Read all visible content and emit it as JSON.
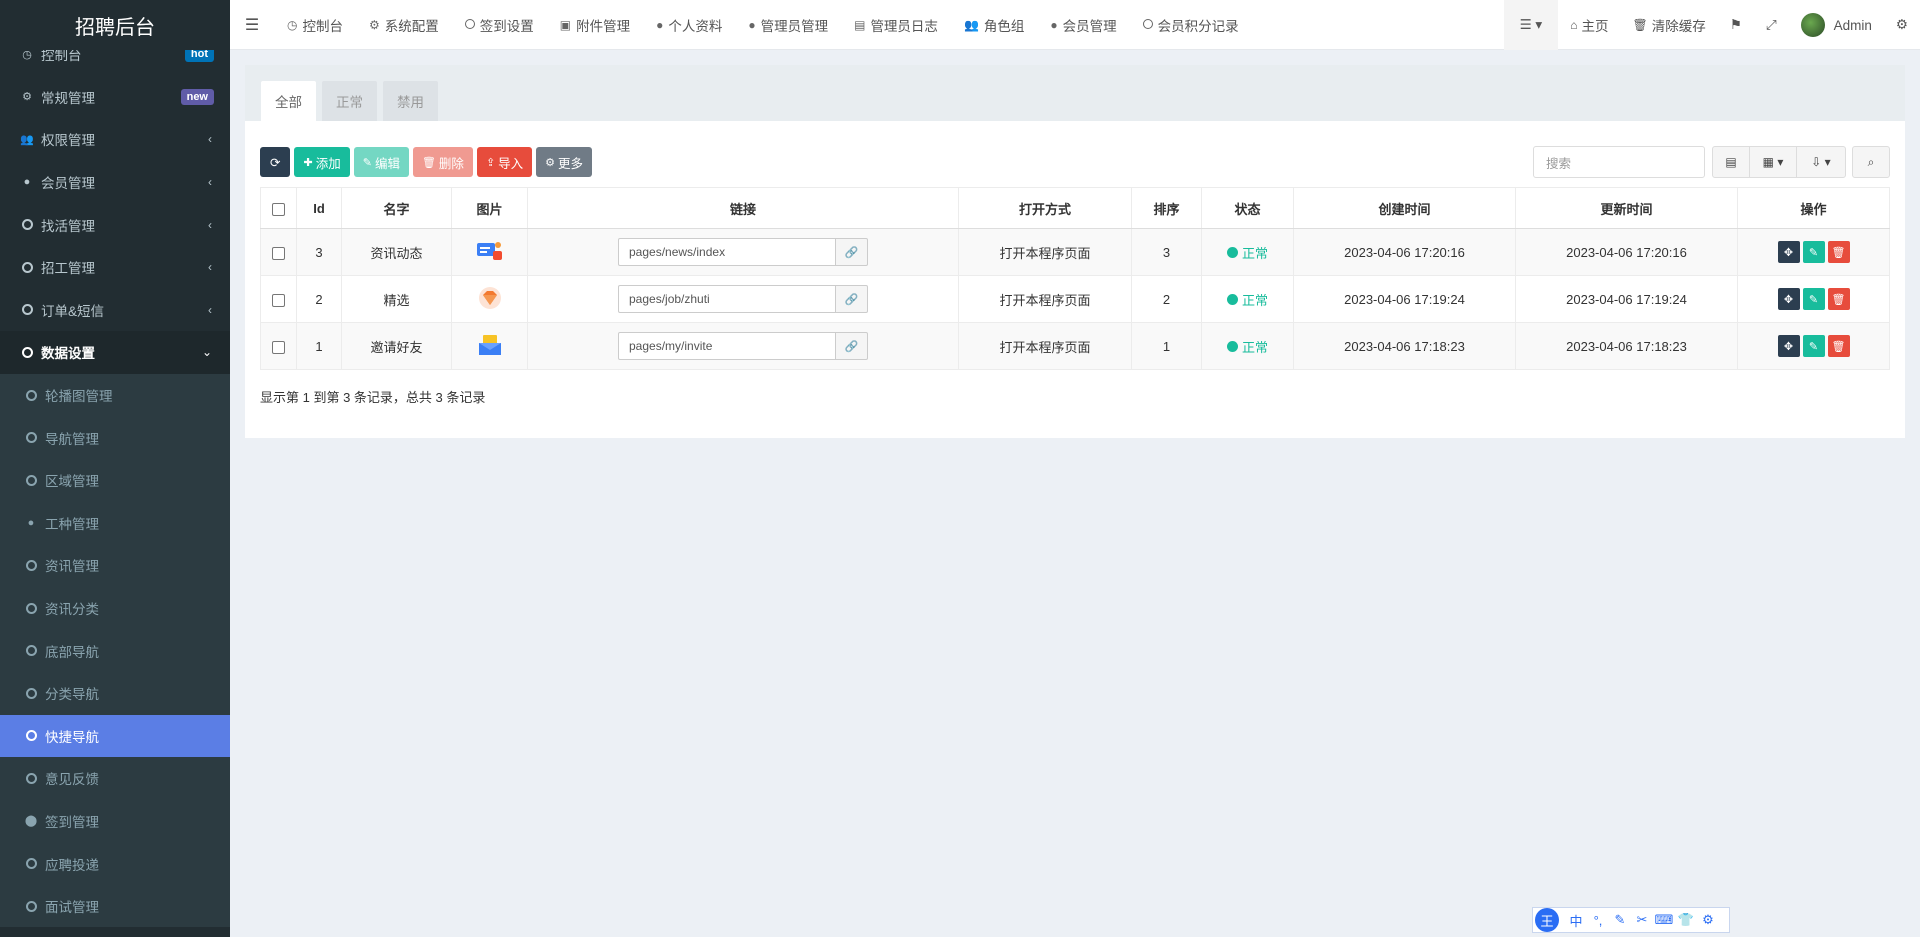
{
  "brand": {
    "title": "招聘后台"
  },
  "sidebar": {
    "items": [
      {
        "label": "控制台",
        "icon": "dashboard-icon",
        "badge": "hot",
        "badge_color": "#0073b7"
      },
      {
        "label": "常规管理",
        "icon": "cogs-icon",
        "badge": "new",
        "badge_color": "#605ca8"
      },
      {
        "label": "权限管理",
        "icon": "users-icon",
        "chevron": "‹"
      },
      {
        "label": "会员管理",
        "icon": "user-circle-icon",
        "chevron": "‹"
      },
      {
        "label": "找活管理",
        "icon": "circle-icon",
        "chevron": "‹"
      },
      {
        "label": "招工管理",
        "icon": "circle-icon",
        "chevron": "‹"
      },
      {
        "label": "订单&短信",
        "icon": "circle-icon",
        "chevron": "‹"
      },
      {
        "label": "数据设置",
        "icon": "circle-icon",
        "chevron": "⌄"
      },
      {
        "label": "轮播图管理",
        "icon": "circle-icon"
      },
      {
        "label": "导航管理",
        "icon": "circle-icon"
      },
      {
        "label": "区域管理",
        "icon": "circle-icon"
      },
      {
        "label": "工种管理",
        "icon": "info-icon"
      },
      {
        "label": "资讯管理",
        "icon": "circle-icon"
      },
      {
        "label": "资讯分类",
        "icon": "circle-icon"
      },
      {
        "label": "底部导航",
        "icon": "circle-icon"
      },
      {
        "label": "分类导航",
        "icon": "circle-icon"
      },
      {
        "label": "快捷导航",
        "icon": "circle-icon"
      },
      {
        "label": "意见反馈",
        "icon": "circle-icon"
      },
      {
        "label": "签到管理",
        "icon": "map-marker-icon"
      },
      {
        "label": "应聘投递",
        "icon": "circle-icon"
      },
      {
        "label": "面试管理",
        "icon": "circle-icon"
      }
    ]
  },
  "topnav": {
    "links": [
      {
        "label": "控制台",
        "icon": "dashboard-icon"
      },
      {
        "label": "系统配置",
        "icon": "gear-icon"
      },
      {
        "label": "签到设置",
        "icon": "circle-icon"
      },
      {
        "label": "附件管理",
        "icon": "file-image-icon"
      },
      {
        "label": "个人资料",
        "icon": "user-icon"
      },
      {
        "label": "管理员管理",
        "icon": "user-icon"
      },
      {
        "label": "管理员日志",
        "icon": "list-alt-icon"
      },
      {
        "label": "角色组",
        "icon": "users-icon"
      },
      {
        "label": "会员管理",
        "icon": "user-icon"
      },
      {
        "label": "会员积分记录",
        "icon": "circle-icon"
      }
    ],
    "home": "主页",
    "clear_cache": "清除缓存",
    "admin": "Admin"
  },
  "tabs": [
    "全部",
    "正常",
    "禁用"
  ],
  "toolbar": {
    "add": "添加",
    "edit": "编辑",
    "delete": "删除",
    "import": "导入",
    "more": "更多"
  },
  "search": {
    "placeholder": "搜索"
  },
  "table": {
    "headers": [
      "Id",
      "名字",
      "图片",
      "链接",
      "打开方式",
      "排序",
      "状态",
      "创建时间",
      "更新时间",
      "操作"
    ],
    "rows": [
      {
        "id": "3",
        "name": "资讯动态",
        "icon": "news-thumb-icon",
        "link": "pages/news/index",
        "open": "打开本程序页面",
        "sort": "3",
        "status": "正常",
        "created": "2023-04-06 17:20:16",
        "updated": "2023-04-06 17:20:16"
      },
      {
        "id": "2",
        "name": "精选",
        "icon": "diamond-thumb-icon",
        "link": "pages/job/zhuti",
        "open": "打开本程序页面",
        "sort": "2",
        "status": "正常",
        "created": "2023-04-06 17:19:24",
        "updated": "2023-04-06 17:19:24"
      },
      {
        "id": "1",
        "name": "邀请好友",
        "icon": "invite-thumb-icon",
        "link": "pages/my/invite",
        "open": "打开本程序页面",
        "sort": "1",
        "status": "正常",
        "created": "2023-04-06 17:18:23",
        "updated": "2023-04-06 17:18:23"
      }
    ]
  },
  "pager": {
    "summary": "显示第 1 到第 3 条记录，总共 3 条记录"
  },
  "ime": {
    "items": [
      "中",
      "°,",
      "✎",
      "✂",
      "⌨",
      "👕",
      "⚙"
    ]
  }
}
